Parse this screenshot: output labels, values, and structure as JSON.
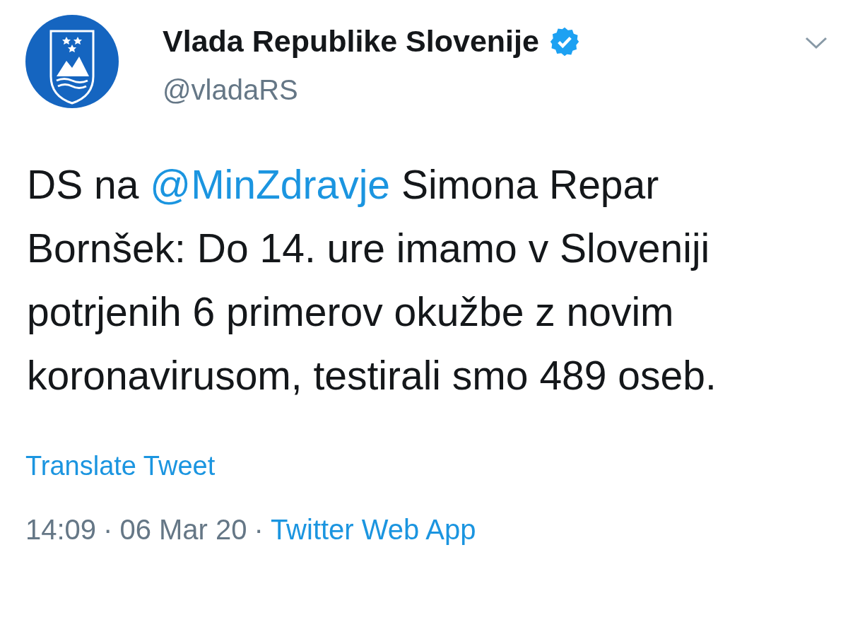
{
  "author": {
    "name": "Vlada Republike Slovenije",
    "verified": true,
    "handle": "@vladaRS"
  },
  "tweet": {
    "before": "DS na",
    "mention": "@MinZdravje",
    "after": "Simona Repar Bornšek: Do 14. ure imamo v Sloveniji potrjenih 6 primerov okužbe z novim koronavirusom, testirali smo 489 oseb."
  },
  "translate": "Translate Tweet",
  "meta": {
    "time": "14:09",
    "separator_1": "·",
    "date": "06 Mar 20",
    "separator_2": "·",
    "source": "Twitter Web App"
  }
}
